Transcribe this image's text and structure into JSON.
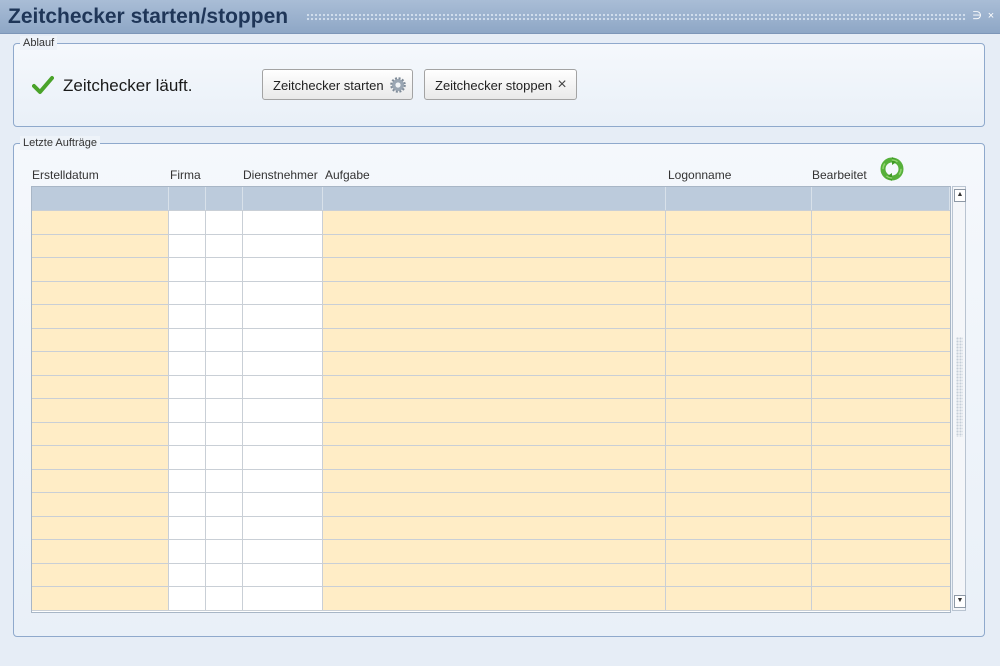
{
  "window": {
    "title": "Zeitchecker starten/stoppen",
    "minimize_icon": "minimize-icon",
    "close_icon": "close-icon"
  },
  "ablauf": {
    "legend": "Ablauf",
    "status_icon": "checkmark-icon",
    "status_text": "Zeitchecker läuft.",
    "start_button": "Zeitchecker starten",
    "start_icon": "gear-icon",
    "stop_button": "Zeitchecker stoppen",
    "stop_icon": "close-icon"
  },
  "auftraege": {
    "legend": "Letzte Aufträge",
    "refresh_icon": "refresh-icon",
    "columns": [
      "Erstelldatum",
      "Firma",
      "Dienstnehmer",
      "Aufgabe",
      "Logonname",
      "Bearbeitet"
    ],
    "rows": [
      [],
      [],
      [],
      [],
      [],
      [],
      [],
      [],
      [],
      [],
      [],
      [],
      [],
      [],
      [],
      [],
      []
    ]
  },
  "colors": {
    "titlebar": "#8ea7c6",
    "title_text": "#1f3658",
    "row_highlight": "#ffedc6",
    "header_row": "#bccbdc",
    "accent_green": "#4aa32a"
  }
}
